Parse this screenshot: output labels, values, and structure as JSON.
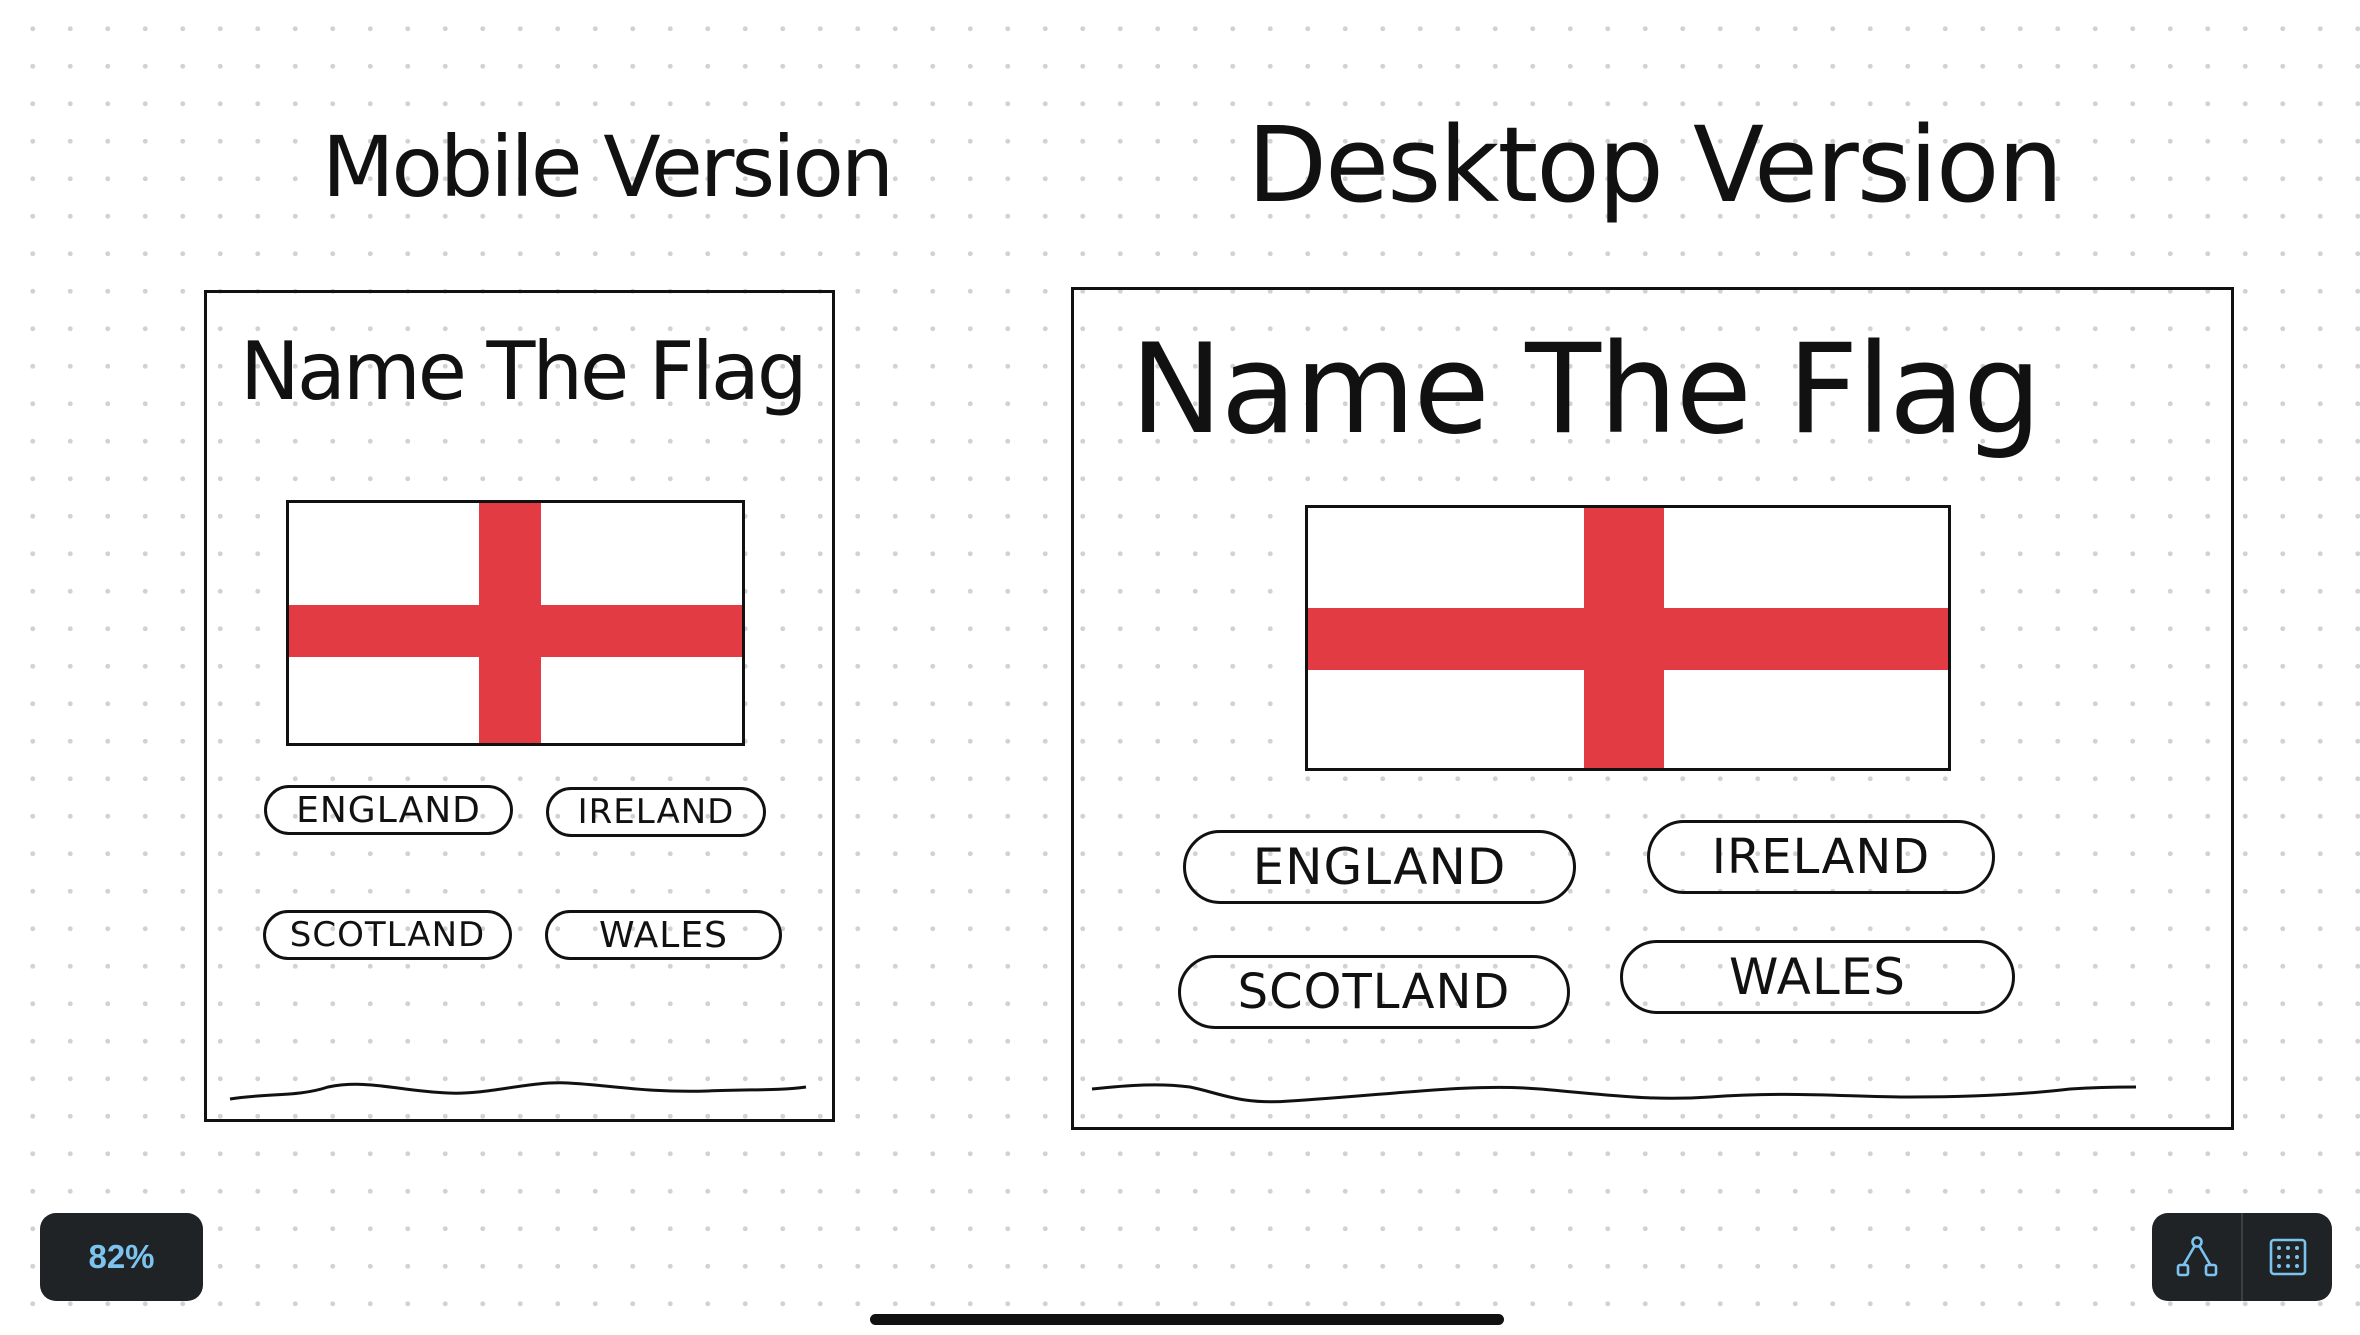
{
  "canvas": {
    "zoom_label": "82%",
    "grid_dot_color": "#cfd3d8"
  },
  "mobile": {
    "heading": "Mobile Version",
    "app_title": "Name The Flag",
    "options": [
      "ENGLAND",
      "IRELAND",
      "SCOTLAND",
      "WALES"
    ]
  },
  "desktop": {
    "heading": "Desktop Version",
    "app_title": "Name The Flag",
    "options": [
      "ENGLAND",
      "IRELAND",
      "SCOTLAND",
      "WALES"
    ]
  },
  "flag": {
    "cross_color": "#e23b44",
    "field_color": "#ffffff"
  },
  "toolbar": {
    "tools": [
      {
        "icon": "shape-tool-icon"
      },
      {
        "icon": "grid-icon"
      }
    ]
  }
}
